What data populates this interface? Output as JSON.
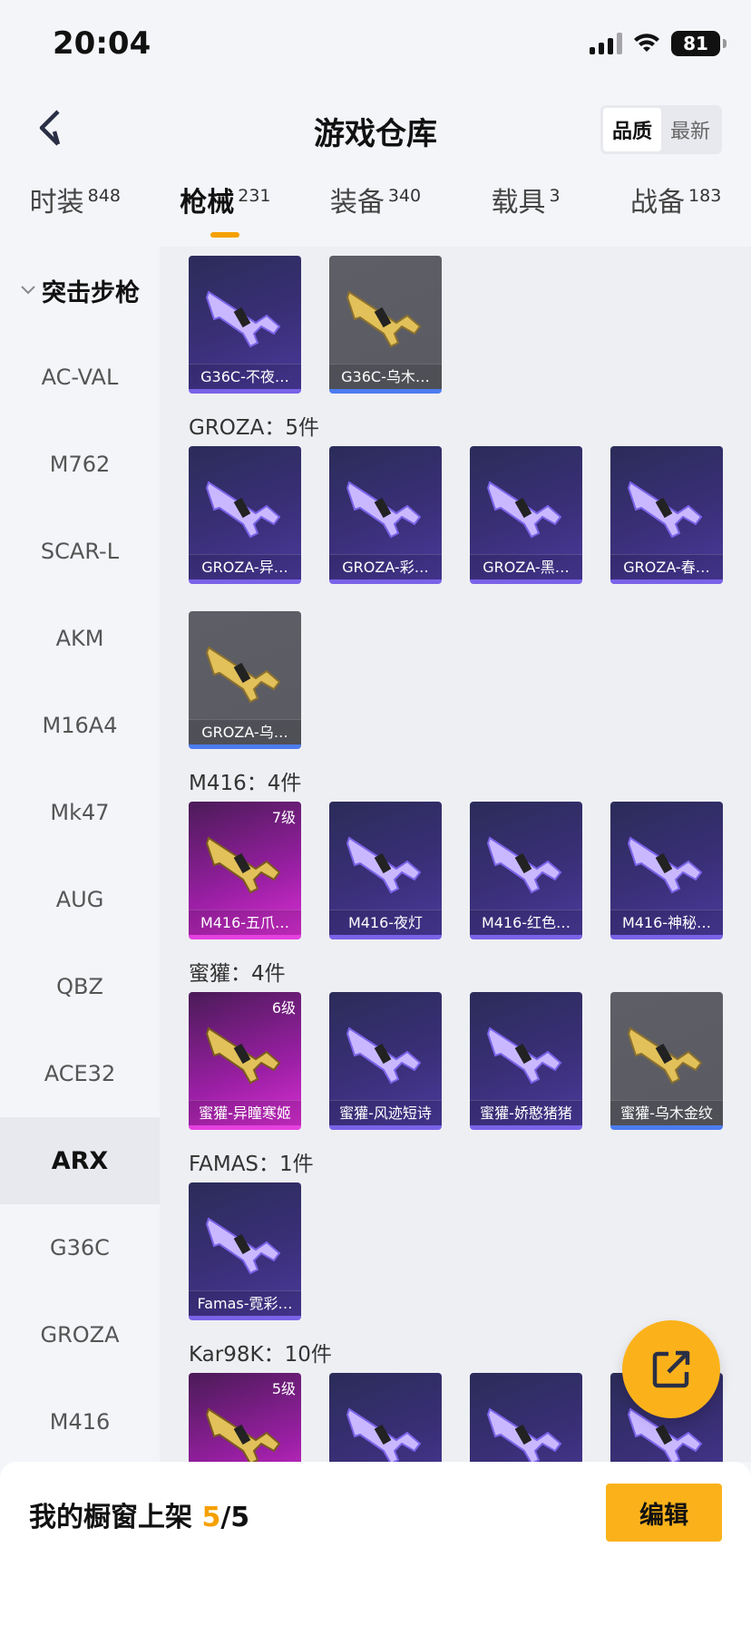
{
  "status_bar": {
    "time": "20:04",
    "battery": "81"
  },
  "header": {
    "title": "游戏仓库",
    "sort_options": [
      "品质",
      "最新"
    ]
  },
  "tabs": [
    {
      "label": "时装",
      "count": "848"
    },
    {
      "label": "枪械",
      "count": "231"
    },
    {
      "label": "装备",
      "count": "340"
    },
    {
      "label": "载具",
      "count": "3"
    },
    {
      "label": "战备",
      "count": "183"
    }
  ],
  "sidebar": {
    "category": "突击步枪",
    "items": [
      "AC-VAL",
      "M762",
      "SCAR-L",
      "AKM",
      "M16A4",
      "Mk47",
      "AUG",
      "QBZ",
      "ACE32",
      "ARX",
      "G36C",
      "GROZA",
      "M416"
    ]
  },
  "groups": [
    {
      "title": "",
      "items": [
        {
          "name": "G36C-不夜…",
          "rarity": "purple"
        },
        {
          "name": "G36C-乌木…",
          "rarity": "gray"
        }
      ]
    },
    {
      "title": "GROZA：5件",
      "items": [
        {
          "name": "GROZA-异…",
          "rarity": "purple"
        },
        {
          "name": "GROZA-彩…",
          "rarity": "purple"
        },
        {
          "name": "GROZA-黑…",
          "rarity": "purple"
        },
        {
          "name": "GROZA-春…",
          "rarity": "purple"
        },
        {
          "name": "GROZA-乌…",
          "rarity": "gray"
        }
      ]
    },
    {
      "title": "M416：4件",
      "items": [
        {
          "name": "M416-五爪…",
          "rarity": "pink",
          "level": "7级"
        },
        {
          "name": "M416-夜灯",
          "rarity": "purple"
        },
        {
          "name": "M416-红色…",
          "rarity": "purple"
        },
        {
          "name": "M416-神秘…",
          "rarity": "purple"
        }
      ]
    },
    {
      "title": "蜜獾：4件",
      "items": [
        {
          "name": "蜜獾-异瞳寒姬",
          "rarity": "pink",
          "level": "6级"
        },
        {
          "name": "蜜獾-风迹短诗",
          "rarity": "purple"
        },
        {
          "name": "蜜獾-娇憨猪猪",
          "rarity": "purple"
        },
        {
          "name": "蜜獾-乌木金纹",
          "rarity": "gray"
        }
      ]
    },
    {
      "title": "FAMAS：1件",
      "items": [
        {
          "name": "Famas-霓彩…",
          "rarity": "purple"
        }
      ]
    },
    {
      "title": "Kar98K：10件",
      "items": [
        {
          "name": "",
          "rarity": "pink",
          "level": "5级"
        },
        {
          "name": "",
          "rarity": "purple"
        },
        {
          "name": "",
          "rarity": "purple"
        },
        {
          "name": "",
          "rarity": "purple"
        }
      ]
    }
  ],
  "bottom_bar": {
    "label": "我的橱窗上架",
    "current": "5",
    "total": "/5",
    "edit": "编辑"
  },
  "colors": {
    "accent": "#fbb21a",
    "purple_card": "#3a2f78",
    "pink_card": "#c02bbd",
    "gray_card": "#5e5f66"
  }
}
